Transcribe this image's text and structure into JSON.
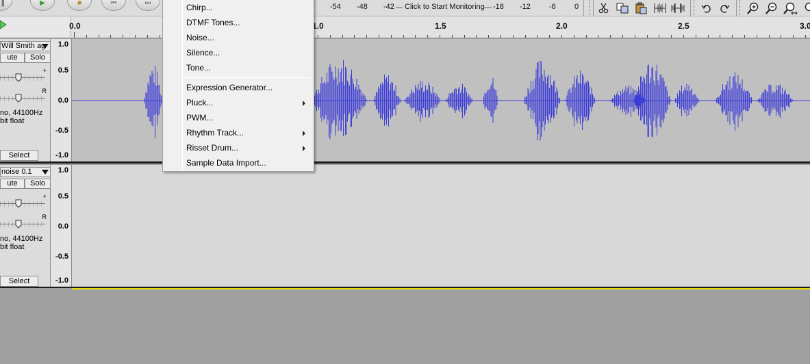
{
  "toolbar": {
    "meter_ticks": [
      "-54",
      "-48",
      "-42",
      "-18",
      "-12",
      "-6",
      "0"
    ],
    "monitor_text": "Click to Start Monitoring",
    "buttons": [
      {
        "name": "pause-button",
        "icon": "pause-icon"
      },
      {
        "name": "play-button",
        "icon": "play-icon"
      },
      {
        "name": "stop-button",
        "icon": "stop-icon"
      },
      {
        "name": "skip-start-button",
        "icon": "skip-start-icon"
      },
      {
        "name": "skip-end-button",
        "icon": "skip-end-icon"
      }
    ],
    "edit_tools": [
      "cut-icon",
      "copy-icon",
      "paste-icon",
      "trim-icon",
      "silence-icon",
      "undo-icon",
      "redo-icon",
      "zoom-in-icon",
      "zoom-out-icon",
      "fit-selection-icon"
    ]
  },
  "ruler": {
    "labels": [
      "0.0",
      "1.0",
      "1.5",
      "2.0",
      "2.5",
      "3.0"
    ]
  },
  "tracks": [
    {
      "name": "Will Smith ag",
      "mute": "ute",
      "solo": "Solo",
      "gain_symbol": "+",
      "pan_symbol": "R",
      "info_line1": "no, 44100Hz",
      "info_line2": "bit float",
      "select": "Select",
      "scale": [
        "1.0",
        "0.5",
        "0.0",
        "-0.5",
        "-1.0"
      ],
      "has_audio": true
    },
    {
      "name": "noise 0.1",
      "mute": "ute",
      "solo": "Solo",
      "gain_symbol": "+",
      "pan_symbol": "R",
      "info_line1": "no, 44100Hz",
      "info_line2": "bit float",
      "select": "Select",
      "scale": [
        "1.0",
        "0.5",
        "0.0",
        "-0.5",
        "-1.0"
      ],
      "has_audio": false
    }
  ],
  "menu": {
    "items": [
      {
        "label": "Chirp...",
        "submenu": false
      },
      {
        "label": "DTMF Tones...",
        "submenu": false
      },
      {
        "label": "Noise...",
        "submenu": false
      },
      {
        "label": "Silence...",
        "submenu": false
      },
      {
        "label": "Tone...",
        "submenu": false
      },
      {
        "separator": true
      },
      {
        "label": "Expression Generator...",
        "submenu": false
      },
      {
        "label": "Pluck...",
        "submenu": true
      },
      {
        "label": "PWM...",
        "submenu": false
      },
      {
        "label": "Rhythm Track...",
        "submenu": true
      },
      {
        "label": "Risset Drum...",
        "submenu": true
      },
      {
        "label": "Sample Data Import...",
        "submenu": false
      }
    ]
  },
  "colors": {
    "waveform": "#3c3cd8",
    "track_bg_selected": "#c0c0c0",
    "track_bg": "#d8d8d8",
    "workspace": "#a0a0a0",
    "selection_edge": "#e8e000"
  }
}
